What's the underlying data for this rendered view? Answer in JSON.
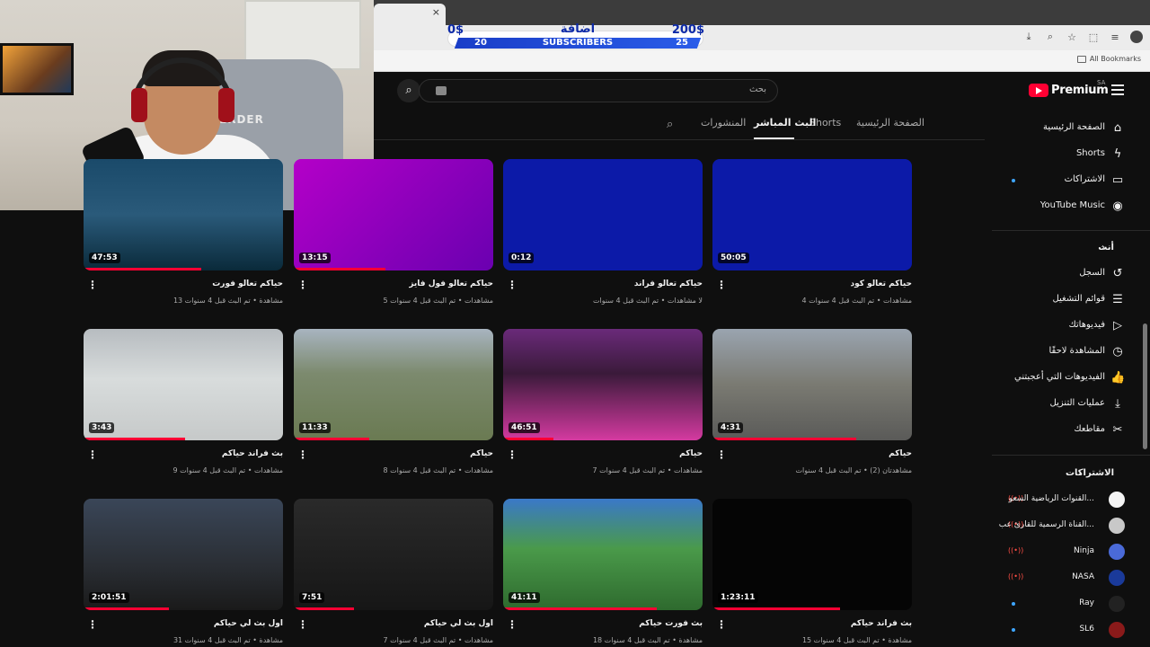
{
  "overlay": {
    "left_money": "0$",
    "title": "اضافة",
    "right_money": "200$",
    "left_count": "20",
    "subscribers": "SUBSCRIBERS",
    "right_count": "25"
  },
  "webcam": {
    "chair_brand": "ERDER"
  },
  "browser": {
    "tab_close": "×",
    "bookmarks_label": "All Bookmarks",
    "toolbar_icons": [
      "⤓",
      "⌕",
      "☆",
      "⬚",
      "≡"
    ]
  },
  "masthead": {
    "search_placeholder": "بحث",
    "search_icon": "⌕",
    "logo_text": "Premium",
    "region": "SA"
  },
  "tabs": [
    {
      "label": "الصفحة الرئيسية",
      "active": false
    },
    {
      "label": "Shorts",
      "active": false
    },
    {
      "label": "البث المباشر",
      "active": true
    },
    {
      "label": "المنشورات",
      "active": false
    }
  ],
  "videos": [
    {
      "title": "حياكم تعالو كود",
      "meta": "4 مشاهدات • تم البث قبل 4 سنوات",
      "duration": "50:05",
      "scene": "scene-blue"
    },
    {
      "title": "حياكم تعالو فراند",
      "meta": "لا مشاهدات • تم البث قبل 4 سنوات",
      "duration": "0:12",
      "scene": "scene-blue"
    },
    {
      "title": "حياكم تعالو فول فايز",
      "meta": "5 مشاهدات • تم البث قبل 4 سنوات",
      "duration": "13:15",
      "scene": "scene-purple"
    },
    {
      "title": "حياكم تعالو فورت",
      "meta": "13 مشاهدة • تم البث قبل 4 سنوات",
      "duration": "47:53",
      "scene": "scene-fort2"
    },
    {
      "title": "حياكم",
      "meta": "مشاهدتان (2) • تم البث قبل 4 سنوات",
      "duration": "4:31",
      "scene": "scene-city"
    },
    {
      "title": "حياكم",
      "meta": "7 مشاهدات • تم البث قبل 4 سنوات",
      "duration": "46:51",
      "scene": "scene-garage"
    },
    {
      "title": "حياكم",
      "meta": "8 مشاهدات • تم البث قبل 4 سنوات",
      "duration": "11:33",
      "scene": "scene-runway"
    },
    {
      "title": "بث فراند حياكم",
      "meta": "9 مشاهدات • تم البث قبل 4 سنوات",
      "duration": "3:43",
      "scene": "scene-snow"
    },
    {
      "title": "بث فراند حياكم",
      "meta": "15 مشاهدة • تم البث قبل 4 سنوات",
      "duration": "1:23:11",
      "scene": "scene-black"
    },
    {
      "title": "بث فورت حياكم",
      "meta": "18 مشاهدة • تم البث قبل 4 سنوات",
      "duration": "41:11",
      "scene": "scene-fort"
    },
    {
      "title": "اول بث لي حياكم",
      "meta": "7 مشاهدات • تم البث قبل 4 سنوات",
      "duration": "7:51",
      "scene": "scene-dark"
    },
    {
      "title": "اول بث لي حياكم",
      "meta": "31 مشاهدة • تم البث قبل 4 سنوات",
      "duration": "2:01:51",
      "scene": "scene-night"
    }
  ],
  "sidebar": {
    "main": [
      {
        "label": "الصفحة الرئيسية",
        "icon": "⌂",
        "name": "home"
      },
      {
        "label": "Shorts",
        "icon": "ϟ",
        "name": "shorts"
      },
      {
        "label": "الاشتراكات",
        "icon": "▭",
        "name": "subscriptions"
      },
      {
        "label": "YouTube Music",
        "icon": "◉",
        "name": "music"
      }
    ],
    "you_section": "أنت",
    "you": [
      {
        "label": "السجل",
        "icon": "↺",
        "name": "history"
      },
      {
        "label": "قوائم التشغيل",
        "icon": "☰",
        "name": "playlists"
      },
      {
        "label": "فيديوهاتك",
        "icon": "▷",
        "name": "your-videos"
      },
      {
        "label": "المشاهدة لاحقًا",
        "icon": "◷",
        "name": "watch-later"
      },
      {
        "label": "الفيديوهات التي أعجبتني",
        "icon": "👍",
        "name": "liked"
      },
      {
        "label": "عمليات التنزيل",
        "icon": "⤓",
        "name": "downloads"
      },
      {
        "label": "مقاطعك",
        "icon": "✂",
        "name": "clips"
      }
    ],
    "subs_section": "الاشتراكات",
    "subs": [
      {
        "label": "القنوات الرياضية السعو...",
        "color": "#f4f4f4",
        "live": true
      },
      {
        "label": "القناة الرسمية للقارئ عب...",
        "color": "#c8c8c8",
        "live": true
      },
      {
        "label": "Ninja",
        "color": "#4a6ad8",
        "live": true
      },
      {
        "label": "NASA",
        "color": "#1a3a9a",
        "live": true
      },
      {
        "label": "Ray",
        "color": "#222222",
        "live": false
      },
      {
        "label": "SL6",
        "color": "#8a1a1a",
        "live": false
      }
    ]
  }
}
